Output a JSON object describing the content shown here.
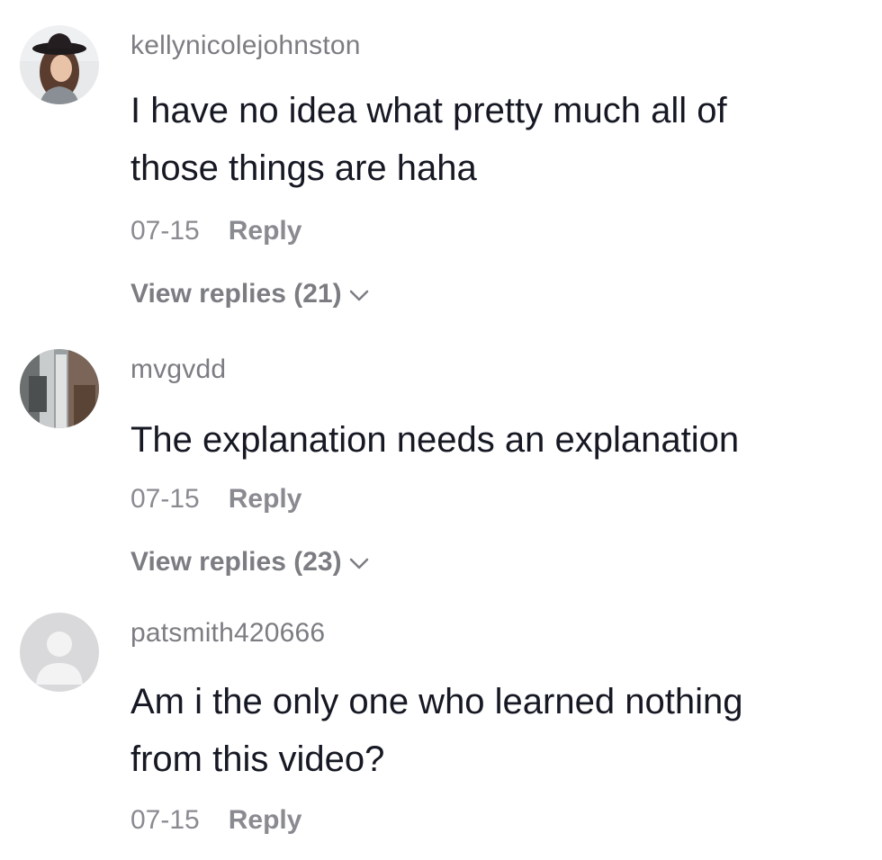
{
  "comments": [
    {
      "username": "kellynicolejohnston",
      "avatar_icon": "user-photo-avatar",
      "text_line1": "I have no idea what pretty much all of",
      "text_line2": "those things are haha",
      "date": "07-15",
      "reply_label": "Reply",
      "view_replies": "View replies (21)"
    },
    {
      "username": "mvgvdd",
      "avatar_icon": "user-photo-avatar",
      "text_line1": "The explanation needs an explanation",
      "date": "07-15",
      "reply_label": "Reply",
      "view_replies": "View replies (23)"
    },
    {
      "username": "patsmith420666",
      "avatar_icon": "default-user-avatar",
      "text_line1": "Am i the only one who learned nothing",
      "text_line2": "from this video?",
      "date": "07-15",
      "reply_label": "Reply"
    }
  ],
  "colors": {
    "username": "#7c7d82",
    "text": "#161823",
    "meta": "#8a8b91",
    "default_avatar_bg": "#d9d9db"
  }
}
